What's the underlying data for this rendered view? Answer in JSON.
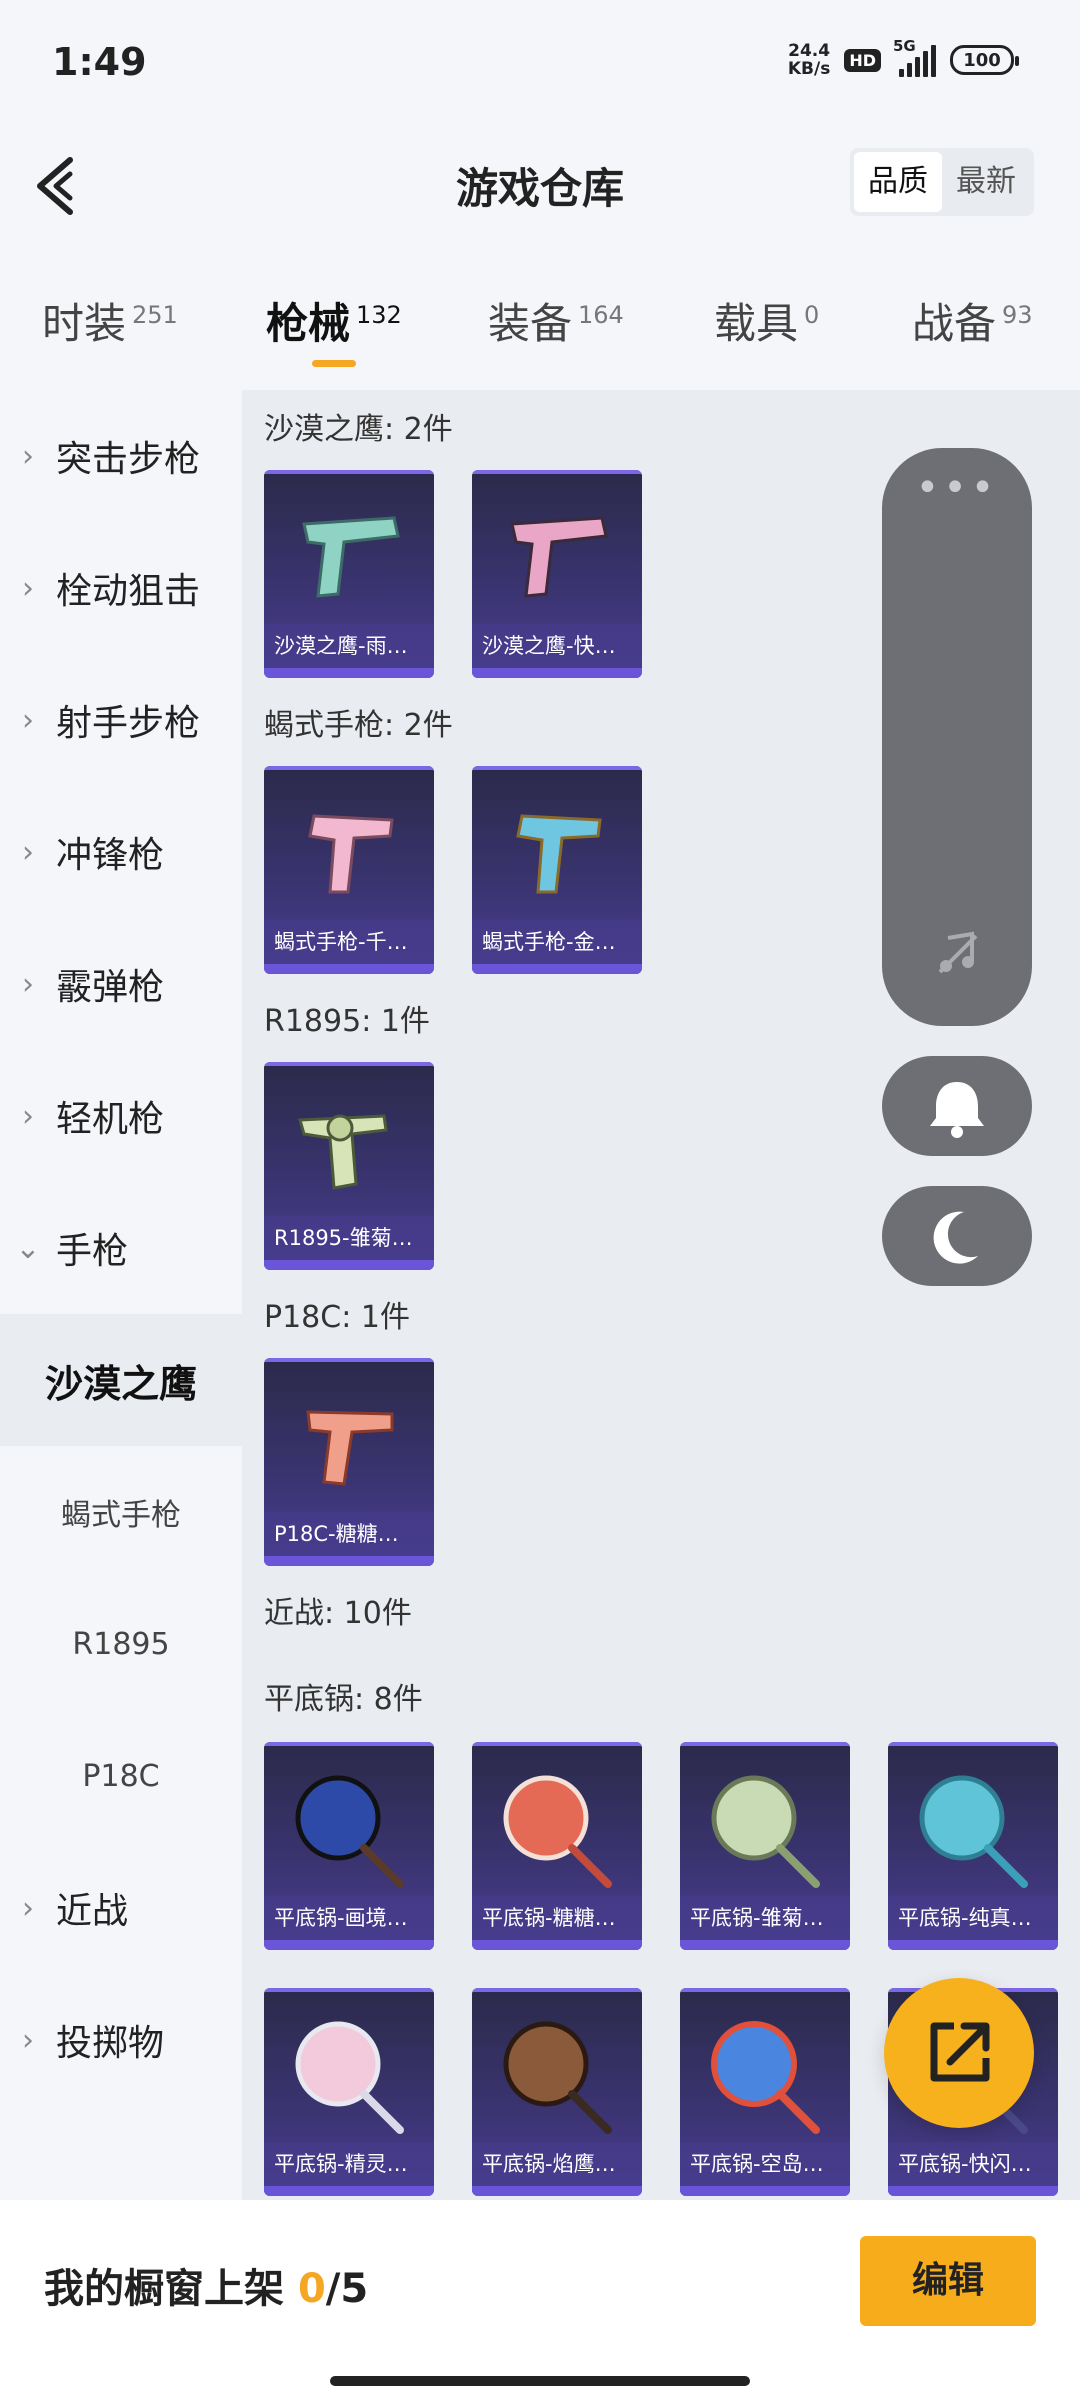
{
  "status": {
    "time": "1:49",
    "net_speed_value": "24.4",
    "net_speed_unit": "KB/s",
    "hd_badge": "HD",
    "network": "5G",
    "battery": "100"
  },
  "header": {
    "title": "游戏仓库",
    "sort_options": [
      "品质",
      "最新"
    ],
    "sort_active": "品质"
  },
  "tabs": [
    {
      "label": "时装",
      "count": "251"
    },
    {
      "label": "枪械",
      "count": "132"
    },
    {
      "label": "装备",
      "count": "164"
    },
    {
      "label": "载具",
      "count": "0"
    },
    {
      "label": "战备",
      "count": "93"
    }
  ],
  "sidebar": {
    "categories": [
      "突击步枪",
      "栓动狙击",
      "射手步枪",
      "冲锋枪",
      "霰弹枪",
      "轻机枪",
      "手枪"
    ],
    "pistol_subs": [
      "沙漠之鹰",
      "蝎式手枪",
      "R1895",
      "P18C"
    ],
    "bottom_categories": [
      "近战",
      "投掷物"
    ]
  },
  "groups": {
    "deagle": {
      "title": "沙漠之鹰: 2件",
      "items": [
        "沙漠之鹰-雨…",
        "沙漠之鹰-快…"
      ]
    },
    "skorpion": {
      "title": "蝎式手枪: 2件",
      "items": [
        "蝎式手枪-千…",
        "蝎式手枪-金…"
      ]
    },
    "r1895": {
      "title": "R1895: 1件",
      "items": [
        "R1895-雏菊…"
      ]
    },
    "p18c": {
      "title": "P18C: 1件",
      "items": [
        "P18C-糖糖…"
      ]
    },
    "melee": {
      "title": "近战: 10件"
    },
    "pan": {
      "title": "平底锅: 8件",
      "items": [
        "平底锅-画境…",
        "平底锅-糖糖…",
        "平底锅-雏菊…",
        "平底锅-纯真…",
        "平底锅-精灵…",
        "平底锅-焰鹰…",
        "平底锅-空岛…",
        "平底锅-快闪…"
      ]
    }
  },
  "bottom_bar": {
    "shelf_label": "我的橱窗上架",
    "shelf_used": "0",
    "shelf_total": "/5",
    "edit_label": "编辑"
  },
  "colors": {
    "accent": "#f5a623",
    "card_bg": "#3b3472",
    "float_panel": "#6d6f75"
  },
  "icons": {
    "back": "chevron-left-icon",
    "float_more": "more-dots-icon",
    "float_music": "music-off-icon",
    "float_bell": "bell-icon",
    "float_moon": "moon-icon",
    "share": "share-external-icon"
  }
}
